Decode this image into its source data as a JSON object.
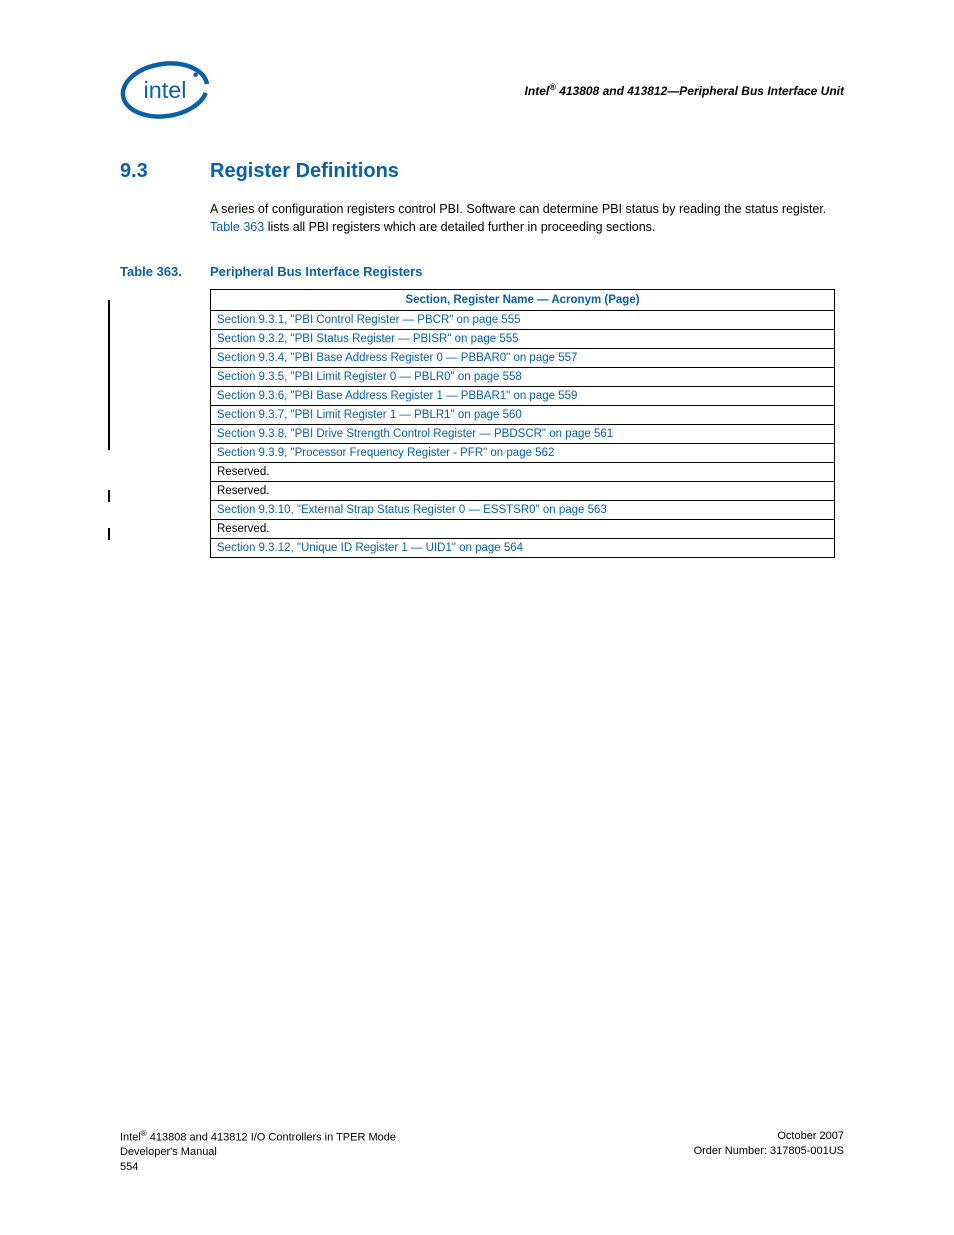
{
  "header": {
    "product_line": "Intel",
    "product_models": "413808 and 413812",
    "unit": "Peripheral Bus Interface Unit"
  },
  "section": {
    "number": "9.3",
    "title": "Register Definitions"
  },
  "paragraph": {
    "pre": "A series of configuration registers control PBI. Software can determine PBI status by reading the status register. ",
    "xref": "Table 363",
    "post": " lists all PBI registers which are detailed further in proceeding sections."
  },
  "table": {
    "label": "Table 363.",
    "caption": "Peripheral Bus Interface Registers",
    "header": "Section, Register Name — Acronym (Page)",
    "rows": [
      {
        "text": "Section 9.3.1, \"PBI Control Register — PBCR\" on page 555",
        "link": true
      },
      {
        "text": "Section 9.3.2, \"PBI Status Register — PBISR\" on page 555",
        "link": true
      },
      {
        "text": "Section 9.3.4, \"PBI Base Address Register 0 — PBBAR0\" on page 557",
        "link": true
      },
      {
        "text": "Section 9.3.5, \"PBI Limit Register 0 — PBLR0\" on page 558",
        "link": true
      },
      {
        "text": "Section 9.3.6, \"PBI Base Address Register 1 — PBBAR1\" on page 559",
        "link": true
      },
      {
        "text": "Section 9.3.7, \"PBI Limit Register 1 — PBLR1\" on page 560",
        "link": true
      },
      {
        "text": "Section 9.3.8, \"PBI Drive Strength Control Register — PBDSCR\" on page 561",
        "link": true
      },
      {
        "text": "Section 9.3.9, \"Processor Frequency Register - PFR\" on page 562",
        "link": true
      },
      {
        "text": "Reserved.",
        "link": false
      },
      {
        "text": "Reserved.",
        "link": false
      },
      {
        "text": "Section 9.3.10, \"External Strap Status Register 0 — ESSTSR0\" on page 563",
        "link": true
      },
      {
        "text": "Reserved.",
        "link": false
      },
      {
        "text": "Section 9.3.12, \"Unique ID Register 1 — UID1\" on page 564",
        "link": true
      }
    ]
  },
  "footer": {
    "left1_pre": "Intel",
    "left1_post": " 413808 and 413812 I/O Controllers in TPER Mode",
    "left2": "Developer's Manual",
    "left3": "554",
    "right1": "October 2007",
    "right2": "Order Number: 317805-001US"
  }
}
